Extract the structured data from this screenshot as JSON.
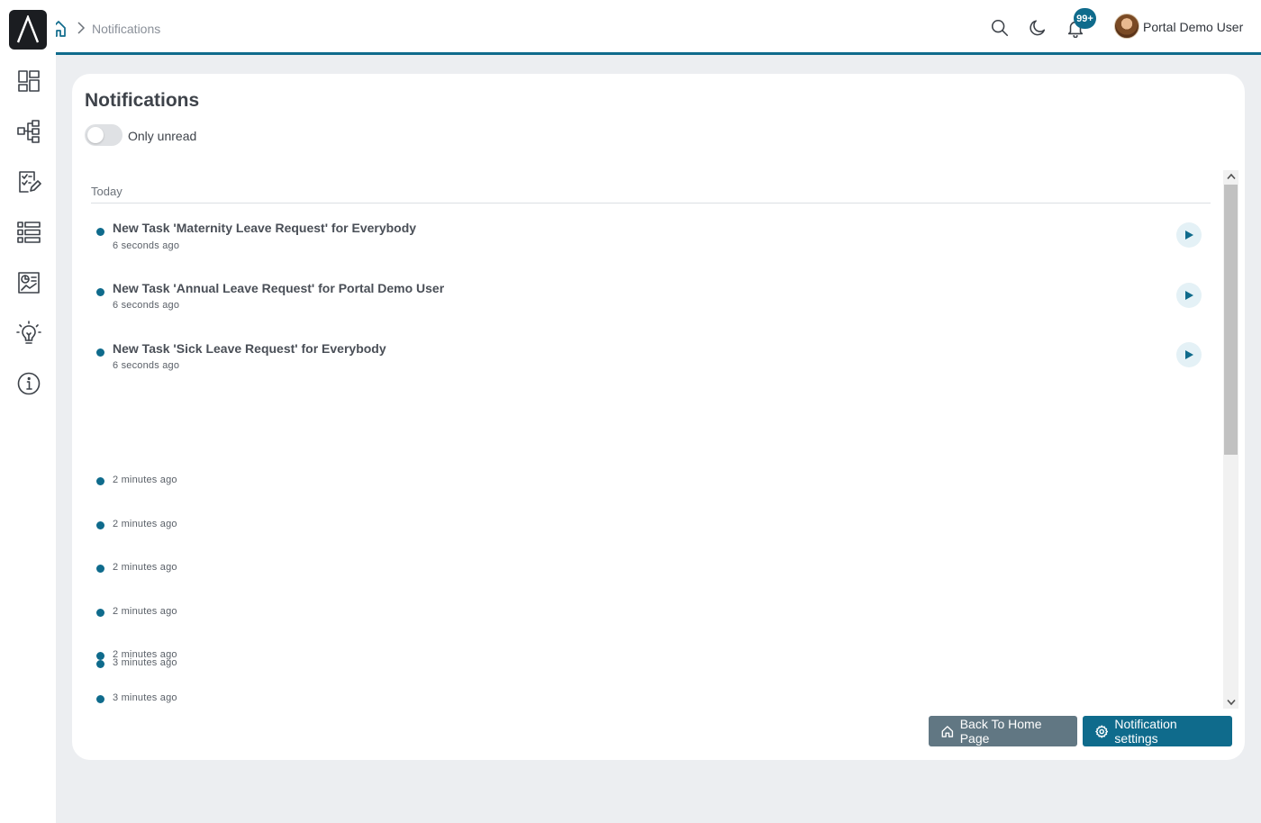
{
  "header": {
    "breadcrumb_current": "Notifications",
    "notification_badge": "99+",
    "user_name": "Portal Demo User"
  },
  "sidebar": {
    "items": [
      {
        "icon": "dashboard-icon"
      },
      {
        "icon": "process-flow-icon"
      },
      {
        "icon": "task-checklist-icon"
      },
      {
        "icon": "list-icon"
      },
      {
        "icon": "report-chart-icon"
      },
      {
        "icon": "lightbulb-icon"
      },
      {
        "icon": "info-icon"
      }
    ]
  },
  "page": {
    "title": "Notifications",
    "toggle_label": "Only unread",
    "toggle_on": false,
    "group_label": "Today"
  },
  "notifications": [
    {
      "title": "New Task 'Maternity Leave Request' for Everybody",
      "time": "6 seconds ago",
      "has_action": true
    },
    {
      "title": "New Task 'Annual Leave Request' for Portal Demo User",
      "time": "6 seconds ago",
      "has_action": true
    },
    {
      "title": "New Task 'Sick Leave Request' for Everybody",
      "time": "6 seconds ago",
      "has_action": true
    },
    {
      "title": "",
      "time": "2 minutes ago",
      "has_action": false
    },
    {
      "title": "",
      "time": "2 minutes ago",
      "has_action": false
    },
    {
      "title": "",
      "time": "2 minutes ago",
      "has_action": false
    },
    {
      "title": "",
      "time": "2 minutes ago",
      "has_action": false
    },
    {
      "title": "",
      "time": "2 minutes ago",
      "has_action": false
    },
    {
      "title": "",
      "time": "3 minutes ago",
      "has_action": false
    },
    {
      "title": "",
      "time": "3 minutes ago",
      "has_action": false
    }
  ],
  "buttons": {
    "back_home": "Back To Home Page",
    "notification_settings": "Notification settings"
  },
  "colors": {
    "accent": "#0f6b8c",
    "secondary_button": "#617783",
    "background": "#eceef1"
  }
}
